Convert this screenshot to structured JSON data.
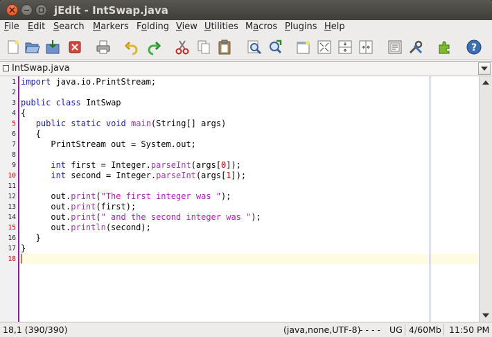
{
  "window": {
    "title": "jEdit - IntSwap.java"
  },
  "menubar": {
    "items": [
      {
        "label": "File",
        "mnemonic": "F",
        "rest": "ile"
      },
      {
        "label": "Edit",
        "mnemonic": "E",
        "rest": "dit"
      },
      {
        "label": "Search",
        "mnemonic": "S",
        "rest": "earch"
      },
      {
        "label": "Markers",
        "mnemonic": "M",
        "rest": "arkers"
      },
      {
        "label": "Folding",
        "mnemonic": "o",
        "pre": "F",
        "rest": "lding"
      },
      {
        "label": "View",
        "mnemonic": "V",
        "rest": "iew"
      },
      {
        "label": "Utilities",
        "mnemonic": "U",
        "rest": "tilities"
      },
      {
        "label": "Macros",
        "mnemonic": "a",
        "pre": "M",
        "rest": "cros"
      },
      {
        "label": "Plugins",
        "mnemonic": "P",
        "rest": "lugins"
      },
      {
        "label": "Help",
        "mnemonic": "H",
        "rest": "elp"
      }
    ]
  },
  "toolbar": {
    "icons": [
      "new-file-icon",
      "open-file-icon",
      "save-file-icon",
      "close-file-icon",
      "print-icon",
      "undo-icon",
      "redo-icon",
      "cut-icon",
      "copy-icon",
      "paste-icon",
      "find-icon",
      "find-next-icon",
      "new-view-icon",
      "unsplit-icon",
      "split-horizontal-icon",
      "split-vertical-icon",
      "buffer-options-icon",
      "global-options-icon",
      "plugin-manager-icon",
      "help-icon"
    ]
  },
  "buffer": {
    "name": "IntSwap.java"
  },
  "editor": {
    "line_numbers": [
      "1",
      "2",
      "3",
      "4",
      "5",
      "6",
      "7",
      "8",
      "9",
      "10",
      "11",
      "12",
      "13",
      "14",
      "15",
      "16",
      "17",
      "18"
    ],
    "lines": [
      [
        {
          "t": "import",
          "c": "kw"
        },
        {
          "t": " java.io.PrintStream;"
        }
      ],
      [],
      [
        {
          "t": "public",
          "c": "kw"
        },
        {
          "t": " "
        },
        {
          "t": "class",
          "c": "kw"
        },
        {
          "t": " IntSwap"
        }
      ],
      [
        {
          "t": "{"
        }
      ],
      [
        {
          "t": "   "
        },
        {
          "t": "public",
          "c": "kw"
        },
        {
          "t": " "
        },
        {
          "t": "static",
          "c": "kw"
        },
        {
          "t": " "
        },
        {
          "t": "void",
          "c": "ty"
        },
        {
          "t": " "
        },
        {
          "t": "main",
          "c": "fn"
        },
        {
          "t": "(String[] args)"
        }
      ],
      [
        {
          "t": "   {"
        }
      ],
      [
        {
          "t": "      PrintStream out = System.out;"
        }
      ],
      [],
      [
        {
          "t": "      "
        },
        {
          "t": "int",
          "c": "ty"
        },
        {
          "t": " first = Integer."
        },
        {
          "t": "parseInt",
          "c": "fn"
        },
        {
          "t": "(args["
        },
        {
          "t": "0",
          "c": "num"
        },
        {
          "t": "]);"
        }
      ],
      [
        {
          "t": "      "
        },
        {
          "t": "int",
          "c": "ty"
        },
        {
          "t": " second = Integer."
        },
        {
          "t": "parseInt",
          "c": "fn"
        },
        {
          "t": "(args["
        },
        {
          "t": "1",
          "c": "num"
        },
        {
          "t": "]);"
        }
      ],
      [],
      [
        {
          "t": "      out."
        },
        {
          "t": "print",
          "c": "fn"
        },
        {
          "t": "("
        },
        {
          "t": "\"The first integer was \"",
          "c": "str"
        },
        {
          "t": ");"
        }
      ],
      [
        {
          "t": "      out."
        },
        {
          "t": "print",
          "c": "fn"
        },
        {
          "t": "(first);"
        }
      ],
      [
        {
          "t": "      out."
        },
        {
          "t": "print",
          "c": "fn"
        },
        {
          "t": "("
        },
        {
          "t": "\" and the second integer was \"",
          "c": "str"
        },
        {
          "t": ");"
        }
      ],
      [
        {
          "t": "      out."
        },
        {
          "t": "println",
          "c": "fn"
        },
        {
          "t": "(second);"
        }
      ],
      [
        {
          "t": "   }"
        }
      ],
      [
        {
          "t": "}"
        }
      ],
      []
    ]
  },
  "statusbar": {
    "caret": "18,1 (390/390)",
    "mode": "(java,none,UTF-8)",
    "flags": "- - - -",
    "ug": "UG",
    "memory": "4/60Mb",
    "time": "11:50 PM"
  }
}
